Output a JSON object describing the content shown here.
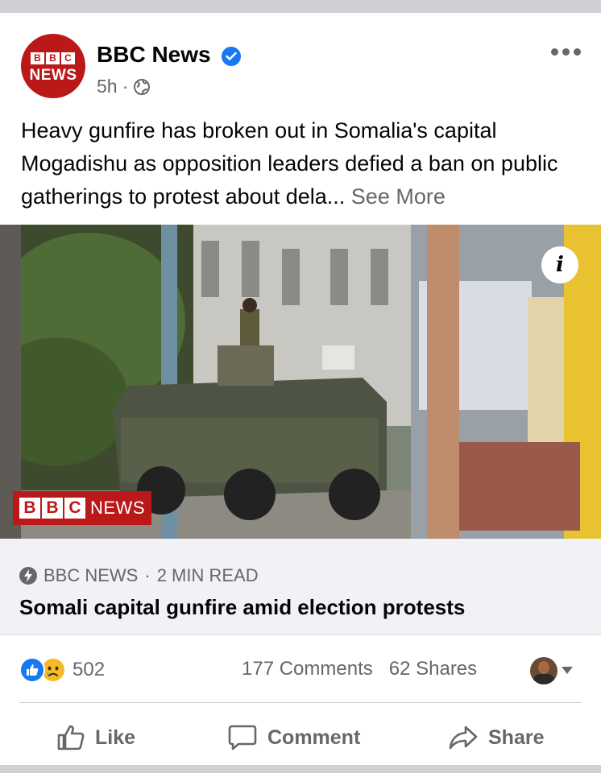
{
  "post": {
    "page_name": "BBC News",
    "avatar": {
      "blocks": [
        "B",
        "B",
        "C"
      ],
      "sub": "NEWS"
    },
    "time": "5h",
    "separator": "·",
    "caption": "Heavy gunfire has broken out in Somalia's capital Mogadishu as opposition leaders defied a ban on public gatherings to protest about dela...",
    "see_more": "See More"
  },
  "image": {
    "info_glyph": "i",
    "watermark": {
      "blocks": [
        "B",
        "B",
        "C"
      ],
      "text": "NEWS"
    }
  },
  "link": {
    "source": "BBC NEWS",
    "separator": "·",
    "read_time": "2 MIN READ",
    "title": "Somali capital gunfire amid election protests"
  },
  "stats": {
    "reactions_count": "502",
    "comments": "177 Comments",
    "shares": "62 Shares"
  },
  "actions": {
    "like": "Like",
    "comment": "Comment",
    "share": "Share"
  },
  "icons": {
    "verified": "verified-badge-icon",
    "audience": "globe-icon",
    "more": "more-options-icon",
    "instant": "lightning-icon",
    "like": "thumbs-up-icon",
    "sad": "sad-face-icon",
    "comment": "speech-bubble-icon",
    "share": "share-arrow-icon"
  },
  "colors": {
    "bbc_red": "#bb1919",
    "facebook_blue": "#1877f2",
    "muted_text": "#65676b",
    "link_bg": "#f0f2f5"
  }
}
